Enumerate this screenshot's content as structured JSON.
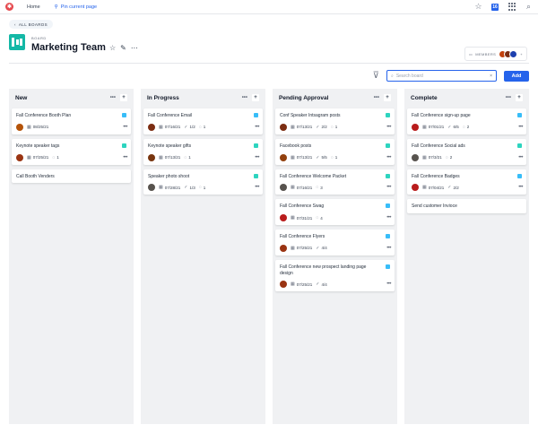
{
  "topbar": {
    "home_label": "Home",
    "pin_label": "Pin current page",
    "calendar_badge": "16"
  },
  "header": {
    "back_label": "ALL BOARDS",
    "board_label": "BOARD",
    "title": "Marketing Team",
    "members_label": "MEMBERS",
    "members_add": "+"
  },
  "toolbar": {
    "search_placeholder": "Search board",
    "add_label": "Add"
  },
  "colors": {
    "accent": "#2563eb",
    "teal": "#14b8a6",
    "tag_blue": "#38bdf8",
    "tag_teal": "#2dd4bf"
  },
  "columns": [
    {
      "title": "New",
      "cards": [
        {
          "title": "Fall Conference Booth Plan",
          "date": "08/25/21",
          "tag": "blue",
          "avatar": "#b45309"
        },
        {
          "title": "Keynote speaker tags",
          "date": "07/25/21",
          "comments": "1",
          "tag": "teal",
          "avatar": "#9a3412"
        },
        {
          "title": "Call Booth Venders"
        }
      ]
    },
    {
      "title": "In Progress",
      "cards": [
        {
          "title": "Fall Conference Email",
          "date": "07/16/21",
          "checks": "1/2",
          "comments": "1",
          "tag": "blue",
          "avatar": "#7c2d12"
        },
        {
          "title": "Keynote speaker gifts",
          "date": "07/13/21",
          "comments": "1",
          "tag": "teal",
          "avatar": "#78350f"
        },
        {
          "title": "Speaker photo shoot",
          "date": "07/28/21",
          "comments": "1",
          "checks": "1/3",
          "tag": "teal",
          "avatar": "#57534e"
        }
      ]
    },
    {
      "title": "Pending Approval",
      "cards": [
        {
          "title": "Conf Speaker Intsagram posts",
          "date": "07/13/21",
          "checks": "2/2",
          "comments": "1",
          "tag": "teal",
          "avatar": "#7c2d12"
        },
        {
          "title": "Facebook posts",
          "date": "07/13/21",
          "checks": "5/5",
          "comments": "1",
          "tag": "teal",
          "avatar": "#92400e"
        },
        {
          "title": "Fall Conference Welcome Packet",
          "date": "07/16/21",
          "comments": "3",
          "tag": "teal",
          "avatar": "#57534e"
        },
        {
          "title": "Fall Conference Swag",
          "date": "07/31/21",
          "comments": "4",
          "tag": "blue",
          "avatar": "#b91c1c"
        },
        {
          "title": "Fall Conference Flyers",
          "date": "07/25/21",
          "checks": "4/4",
          "tag": "blue",
          "avatar": "#9a3412"
        },
        {
          "title": "Fall Conference new prospect landing page design",
          "date": "07/25/21",
          "checks": "4/4",
          "tag": "blue",
          "avatar": "#9a3412"
        }
      ]
    },
    {
      "title": "Complete",
      "cards": [
        {
          "title": "Fall Conference sign-up page",
          "date": "07/01/21",
          "checks": "6/5",
          "comments": "2",
          "tag": "blue",
          "avatar": "#b91c1c"
        },
        {
          "title": "Fall Conference Social ads",
          "date": "07/3/21",
          "comments": "2",
          "tag": "teal",
          "avatar": "#57534e"
        },
        {
          "title": "Fall Conference Badges",
          "date": "07/04/21",
          "checks": "2/2",
          "tag": "blue",
          "avatar": "#b91c1c"
        },
        {
          "title": "Send customer Invioce"
        }
      ]
    }
  ]
}
